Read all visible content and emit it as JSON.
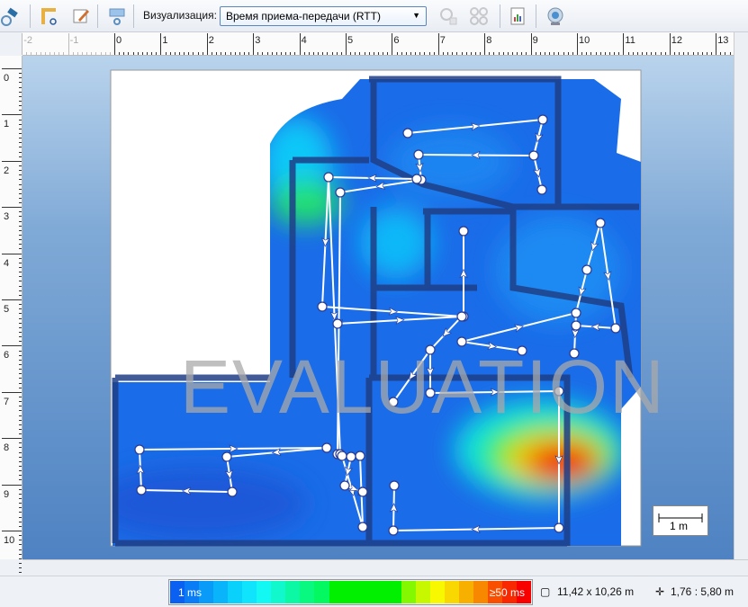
{
  "toolbar": {
    "buttons": [
      {
        "name": "satellite-icon"
      },
      {
        "name": "ruler-path-icon"
      },
      {
        "name": "edit-icon"
      },
      {
        "name": "marker-icon"
      },
      {
        "name": "ap-check-icon"
      },
      {
        "name": "ap-grid-icon"
      },
      {
        "name": "report-icon"
      },
      {
        "name": "webcam-icon"
      }
    ],
    "visualization_label": "Визуализация:",
    "visualization_value": "Время приема-передачи (RTT)"
  },
  "ruler": {
    "horizontal": [
      "-2",
      "-1",
      "0",
      "1",
      "2",
      "3",
      "4",
      "5",
      "6",
      "7",
      "8",
      "9",
      "10",
      "11",
      "12",
      "13"
    ],
    "vertical": [
      "0",
      "1",
      "2",
      "3",
      "4",
      "5",
      "6",
      "7",
      "8",
      "9",
      "10"
    ]
  },
  "map": {
    "watermark": "EVALUATION",
    "scale_label": "1 m"
  },
  "legend": {
    "min_label": "1 ms",
    "max_label": "≥50 ms",
    "colors": [
      "#0a60f0",
      "#0a7cf5",
      "#0a9af8",
      "#0ab4fa",
      "#0ad0fc",
      "#10e4fc",
      "#14f8f4",
      "#10f8cc",
      "#0cf8a4",
      "#08f880",
      "#04f860",
      "#00f000",
      "#00f000",
      "#00f000",
      "#00f000",
      "#00f000",
      "#84f800",
      "#c8f800",
      "#f8f800",
      "#f8d800",
      "#f8b000",
      "#f88800",
      "#f85000",
      "#f82800",
      "#f80000"
    ]
  },
  "status": {
    "size": "11,42 x 10,26 m",
    "cursor": "1,76 : 5,80 m"
  },
  "colors": {
    "wall": "#1f3e86",
    "path": "#ffffff",
    "arrow": "#1f3e86"
  }
}
